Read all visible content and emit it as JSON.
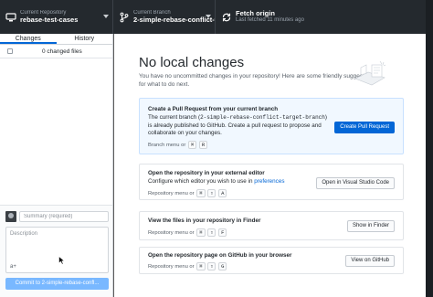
{
  "toolbar": {
    "repository": {
      "label": "Current Repository",
      "value": "rebase-test-cases",
      "icon": "computer-icon"
    },
    "branch": {
      "label": "Current Branch",
      "value": "2-simple-rebase-conflict-t...",
      "icon": "branch-icon"
    },
    "fetch": {
      "label": "Fetch origin",
      "value": "Last fetched 11 minutes ago",
      "icon": "sync-icon"
    }
  },
  "sidebar": {
    "tabs": [
      {
        "label": "Changes",
        "active": true
      },
      {
        "label": "History",
        "active": false
      }
    ],
    "changed_files": "0 changed files",
    "summary_placeholder": "Summary (required)",
    "description_placeholder": "Description",
    "coauthor_glyph": "a+",
    "commit_button": "Commit to 2-simple-rebase-confl..."
  },
  "main": {
    "title": "No local changes",
    "subtitle": "You have no uncommitted changes in your repository! Here are some friendly suggestions for what to do next.",
    "pull_request": {
      "title": "Create a Pull Request from your current branch",
      "text_prefix": "The current branch (",
      "branch_name": "2-simple-rebase-conflict-target-branch",
      "text_suffix": ") is already published to GitHub. Create a pull request to propose and collaborate on your changes.",
      "hint": "Branch menu or",
      "keys": [
        "⌘",
        "R"
      ],
      "button": "Create Pull Request"
    },
    "editor": {
      "title": "Open the repository in your external editor",
      "text_prefix": "Configure which editor you wish to use in",
      "link": "preferences",
      "hint": "Repository menu or",
      "keys": [
        "⌘",
        "⇧",
        "A"
      ],
      "button": "Open in Visual Studio Code"
    },
    "finder": {
      "title": "View the files in your repository in Finder",
      "hint": "Repository menu or",
      "keys": [
        "⌘",
        "⇧",
        "F"
      ],
      "button": "Show in Finder"
    },
    "github": {
      "title": "Open the repository page on GitHub in your browser",
      "hint": "Repository menu or",
      "keys": [
        "⌘",
        "⇧",
        "G"
      ],
      "button": "View on GitHub"
    }
  },
  "colors": {
    "toolbar_bg": "#24292e",
    "accent": "#0366d6",
    "commit_button_disabled": "#79b8ff",
    "pr_card_bg": "#f1f8ff"
  }
}
